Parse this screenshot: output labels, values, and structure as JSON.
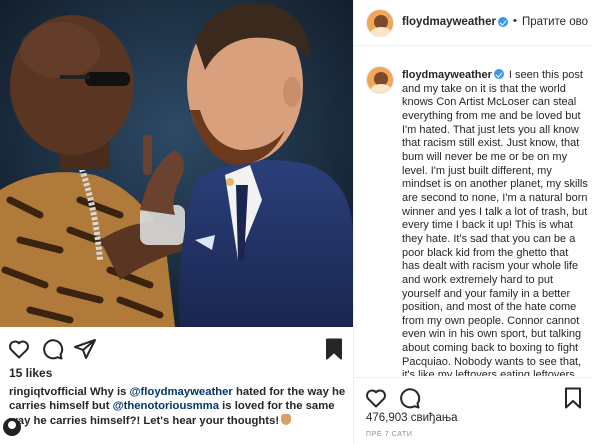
{
  "left_post": {
    "likes": "15 likes",
    "caption": {
      "username": "ringiqtvofficial",
      "text_1": " Why is ",
      "mention_1": "@floydmayweather",
      "text_2": " hated for the way he carries himself but ",
      "mention_2": "@thenotoriousmma",
      "text_3": " is loved for the same way he carries himself?! Let's hear your thoughts!"
    },
    "icons": [
      "heart-icon",
      "comment-icon",
      "share-icon",
      "bookmark-icon"
    ]
  },
  "right_post": {
    "header": {
      "username": "floydmayweather",
      "separator": "•",
      "follow_label": "Пратите ово"
    },
    "caption": {
      "username": "floydmayweather",
      "text": " I seen this post and my take on it is that the world knows Con Artist McLoser can steal everything from me and be loved but I'm hated. That just lets you all know that racism still exist. Just know, that bum will never be me or be on my level. I'm just built different, my mindset is on another planet, my skills are second to none, I'm a natural born winner and yes I talk a lot of trash, but every time I back it up! This is what they hate. It's sad that you can be a poor black kid from the ghetto that has dealt with racism your whole life and work extremely hard to put yourself and your family in a better position, and most of the hate come from my own people. Connor cannot even win in his own sport, but talking about coming back to boxing to fight Pacquiao. Nobody wants to see that, it's like my leftovers eating leftovers."
    },
    "likes": "476,903 свиђања",
    "time": "ПРЕ 7 САТИ",
    "icons": [
      "heart-icon",
      "comment-icon",
      "bookmark-icon"
    ]
  },
  "colors": {
    "text": "#262626",
    "mention": "#00376b",
    "verified": "#3897f0",
    "muted": "#8e8e8e",
    "divider": "#efefef"
  }
}
